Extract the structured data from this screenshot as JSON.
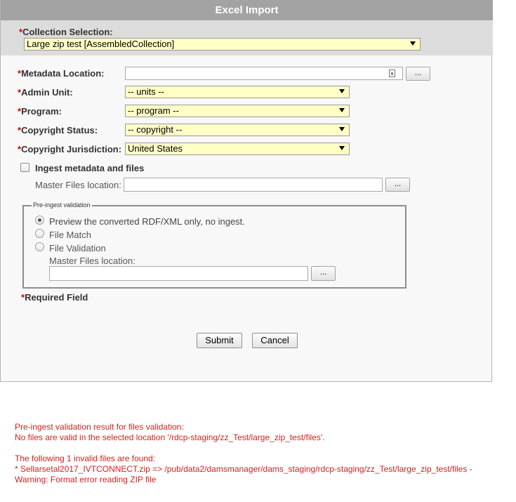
{
  "window": {
    "title": "Excel Import"
  },
  "collection": {
    "label": "Collection Selection:",
    "selected": "Large zip test [AssembledCollection]"
  },
  "form": {
    "metadata_location": {
      "label": "Metadata Location:",
      "value": "",
      "browse": "..."
    },
    "admin_unit": {
      "label": "Admin Unit:",
      "selected": "-- units --"
    },
    "program": {
      "label": "Program:",
      "selected": "-- program --"
    },
    "copyright_status": {
      "label": "Copyright Status:",
      "selected": "-- copyright --"
    },
    "copyright_jurisdiction": {
      "label": "Copyright Jurisdiction:",
      "selected": "United States"
    },
    "ingest": {
      "label": "Ingest metadata and files",
      "checked": false
    },
    "master_files": {
      "label": "Master Files location:",
      "value": "",
      "browse": "..."
    }
  },
  "pre_ingest": {
    "legend": "Pre-ingest validation",
    "options": [
      {
        "label": "Preview the converted RDF/XML only, no ingest.",
        "checked": true
      },
      {
        "label": "File Match",
        "checked": false
      },
      {
        "label": "File Validation",
        "checked": false
      }
    ],
    "master_files_label": "Master Files location:",
    "master_files_value": "",
    "browse": "..."
  },
  "required_note": "Required Field",
  "required_mark": "*",
  "buttons": {
    "submit": "Submit",
    "cancel": "Cancel"
  },
  "results": {
    "line1": "Pre-ingest validation result for files validation:",
    "line2": "No files are valid in the selected location '/rdcp-staging/zz_Test/large_zip_test/files'.",
    "line3": "The following 1 invalid files are found:",
    "line4": "* Sellarsetal2017_IVTCONNECT.zip => /pub/data2/damsmanager/dams_staging/rdcp-staging/zz_Test/large_zip_test/files -",
    "line5": "Warning: Format error reading ZIP file"
  },
  "colors": {
    "title_bar": "#a3a3a3",
    "select_bg": "#ffffc6",
    "required": "#cc0000",
    "error_text": "#d32020"
  }
}
